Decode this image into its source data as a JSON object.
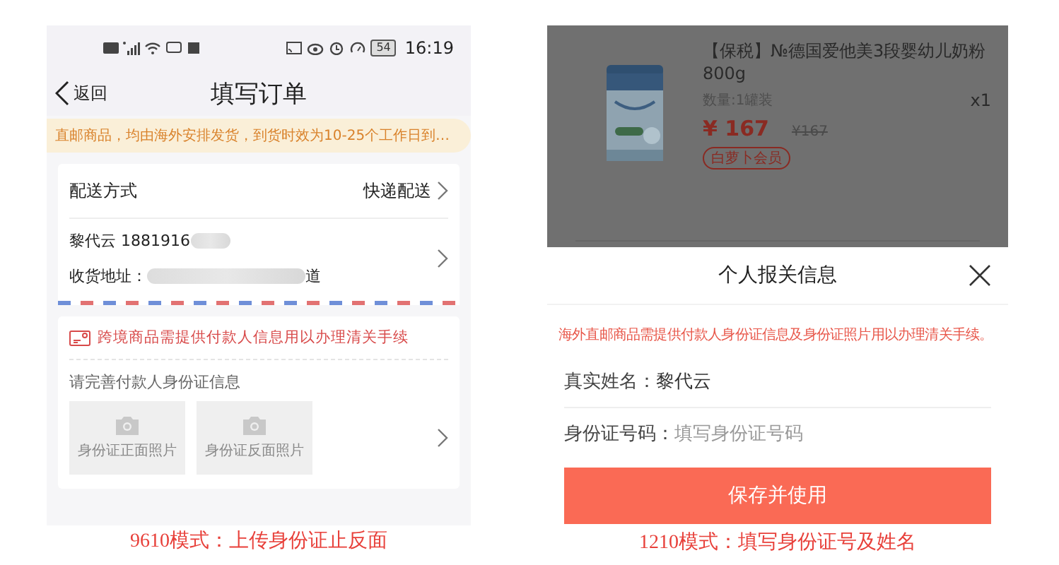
{
  "left_phone": {
    "status_bar": {
      "battery": "54",
      "time": "16:19"
    },
    "nav": {
      "back": "返回",
      "title": "填写订单"
    },
    "notice": "直邮商品，均由海外安排发货，到货时效为10-25个工作日到…",
    "delivery": {
      "label": "配送方式",
      "value": "快递配送"
    },
    "address": {
      "name_phone": "黎代云 1881916",
      "address_label": "收货地址：",
      "address_end": "道"
    },
    "customs": {
      "warning": "跨境商品需提供付款人信息用以办理清关手续",
      "prompt": "请完善付款人身份证信息",
      "photos": [
        "身份证正面照片",
        "身份证反面照片"
      ]
    },
    "caption": "9610模式：上传身份证止反面"
  },
  "right_phone": {
    "product": {
      "title": "【保税】№德国爱他美3段婴幼儿奶粉 800g",
      "spec": "数量:1罐装",
      "quantity": "x1",
      "price": "¥ 167",
      "original_price": "¥167",
      "tag": "白萝卜会员"
    },
    "sheet": {
      "title": "个人报关信息",
      "notice": "海外直邮商品需提供付款人身份证信息及身份证照片用以办理清关手续。",
      "fields": [
        {
          "label": "真实姓名：",
          "value": "黎代云"
        },
        {
          "label": "身份证号码：",
          "placeholder": "填写身份证号码"
        }
      ],
      "button": "保存并使用"
    },
    "caption": "1210模式：填写身份证号及姓名"
  }
}
